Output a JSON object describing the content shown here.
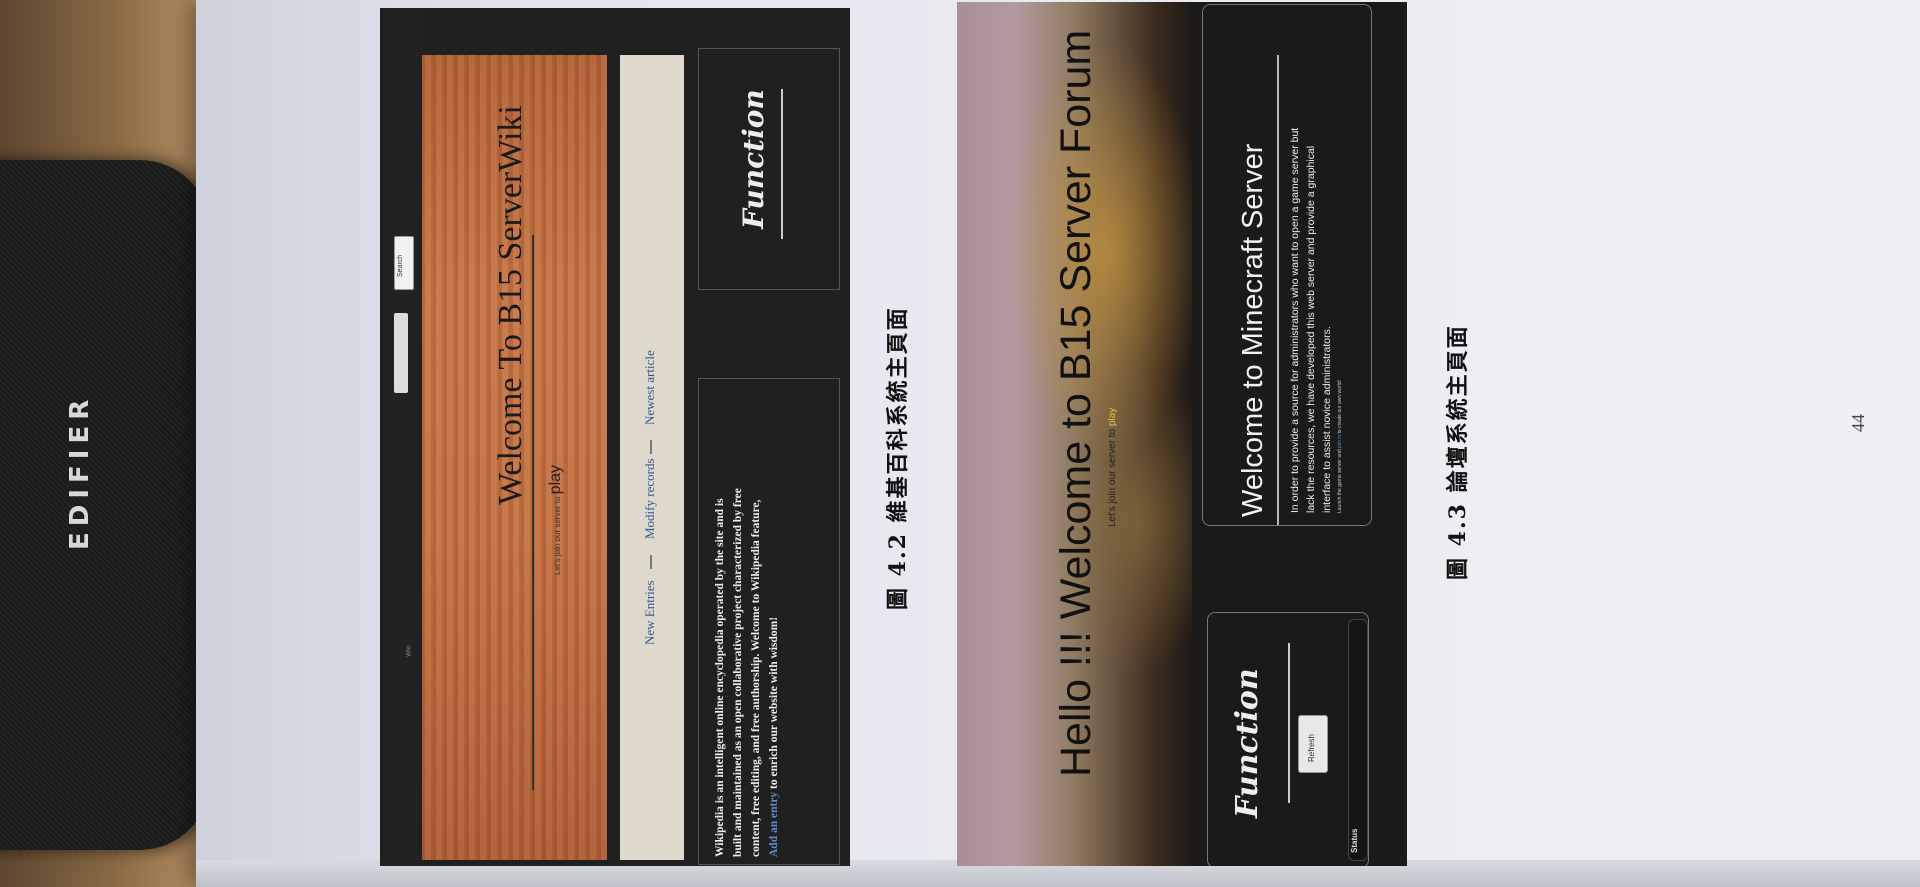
{
  "speaker": {
    "brand": "EDIFIER"
  },
  "figure_4_2": {
    "nav_text": "Wiki",
    "search_button": "Search",
    "title": "Welcome To B15 ServerWiki",
    "subtitle_prefix": "Let's join our server to",
    "subtitle_link": "play",
    "tabs": [
      "New Entries",
      "Modify records",
      "Newest article"
    ],
    "function_title": "Function",
    "description_lines": [
      "Wikipedia is an intelligent online encyclopedia operated by the site and is",
      "built and maintained as an open collaborative project characterized by free",
      "content, free editing, and free authorship. Welcome to Wikipedia feature,",
      "to enrich our website with wisdom!"
    ],
    "description_link": "Add an entry",
    "caption": "圖 4.2 維基百科系統主頁面"
  },
  "figure_4_3": {
    "hello": "Hello !!! Welcome to B15 Server Forum",
    "hello_sub_prefix": "Let's join our server to",
    "hello_sub_link": "play",
    "server_title": "Welcome to Minecraft Server",
    "server_lines": [
      "In order to provide a source for administrators who want to open a game server but",
      "lack the resources, we have developed this web server and provide a graphical",
      "interface to assist novice administrators."
    ],
    "launch_prefix": "Launch the game server and",
    "launch_link": "join in",
    "launch_suffix": "to create our own world!",
    "function_title": "Function",
    "refresh_button": "Refresh",
    "status_label": "Status",
    "caption": "圖 4.3 論壇系統主頁面"
  },
  "page_number": "44"
}
